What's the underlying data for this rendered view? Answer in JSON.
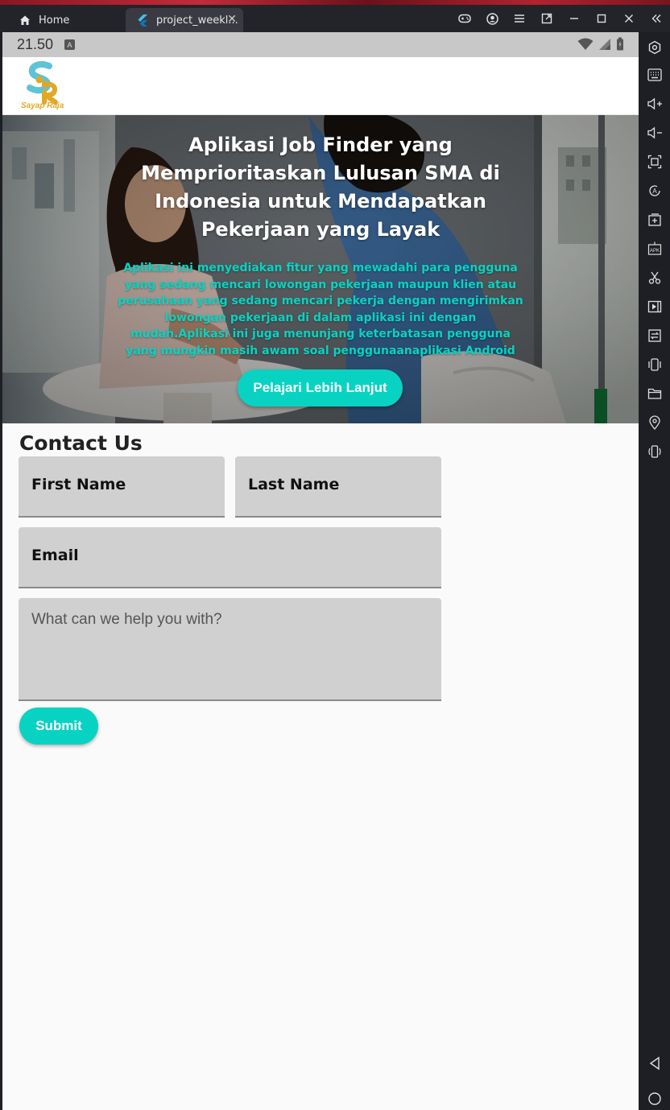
{
  "window": {
    "tabs": [
      {
        "label": "Home",
        "icon": "home-icon"
      },
      {
        "label": "project_weekl...",
        "icon": "flutter-icon"
      }
    ],
    "toolbar_icons": [
      "gamepad-icon",
      "account-icon",
      "menu-icon",
      "popout-icon",
      "minimize-icon",
      "maximize-icon",
      "close-icon",
      "collapse-icon"
    ]
  },
  "sidebar": {
    "icons": [
      "settings-icon",
      "keyboard-icon",
      "volume-up-icon",
      "volume-down-icon",
      "screenshot-icon",
      "auto-rotate-icon",
      "add-screen-icon",
      "apk-icon",
      "cut-icon",
      "video-icon",
      "sync-icon",
      "shake-icon",
      "folder-icon",
      "location-icon",
      "rotate-device-icon",
      "back-icon",
      "home-circle-icon"
    ]
  },
  "status": {
    "time": "21.50",
    "badge": "A"
  },
  "app": {
    "logo_text": "Sayap Raja",
    "hero": {
      "title": "Aplikasi Job Finder yang Memprioritaskan Lulusan SMA di Indonesia untuk Mendapatkan Pekerjaan yang Layak",
      "description": "Aplikasi ini menyediakan fitur yang mewadahi para pengguna yang sedang mencari lowongan pekerjaan maupun klien atau perusahaan yang sedang mencari pekerja dengan mengirimkan lowongan pekerjaan di dalam aplikasi ini dengan mudah.Aplikasi ini juga menunjang keterbatasan pengguna yang mungkin masih awam soal penggunaanaplikasi Android dengan memberikan",
      "button": "Pelajari Lebih Lanjut"
    },
    "contact": {
      "title": "Contact Us",
      "first_name": "First Name",
      "last_name": "Last Name",
      "email": "Email",
      "message_placeholder": "What can we help you with?",
      "submit": "Submit"
    }
  },
  "colors": {
    "accent": "#08d3c3",
    "field_bg": "#d0d0d0",
    "logo_blue": "#5ec3d6",
    "logo_yellow": "#e1a823"
  }
}
